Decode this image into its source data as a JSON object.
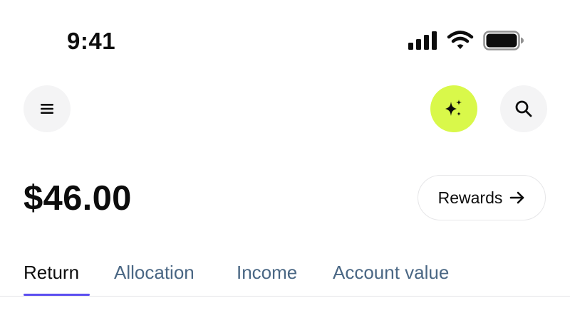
{
  "status_bar": {
    "time": "9:41",
    "icons": [
      "cellular-signal-icon",
      "wifi-icon",
      "battery-icon"
    ]
  },
  "header": {
    "icons": {
      "menu": "menu-icon",
      "assistant": "sparkle-icon",
      "search": "search-icon"
    },
    "accent_color": "#d9f84a"
  },
  "summary": {
    "balance": "$46.00",
    "rewards_label": "Rewards",
    "rewards_icon": "arrow-right-icon"
  },
  "tabs": {
    "items": [
      {
        "label": "Return",
        "active": true
      },
      {
        "label": "Allocation",
        "active": false
      },
      {
        "label": "Income",
        "active": false
      },
      {
        "label": "Account value",
        "active": false
      }
    ],
    "active_color": "#5b4ef0",
    "inactive_color": "#4a6784"
  }
}
